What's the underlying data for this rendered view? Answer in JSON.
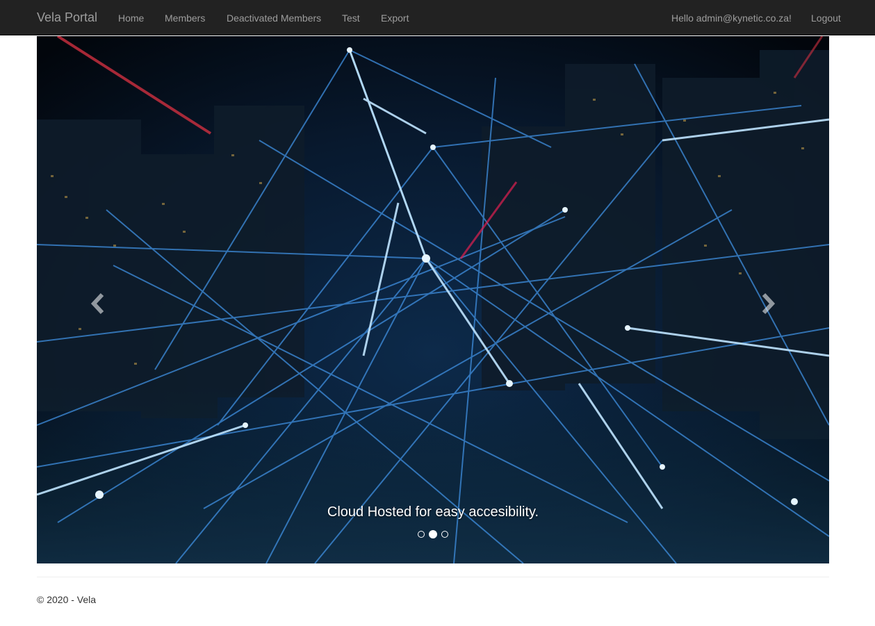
{
  "navbar": {
    "brand": "Vela Portal",
    "items": [
      {
        "label": "Home"
      },
      {
        "label": "Members"
      },
      {
        "label": "Deactivated Members"
      },
      {
        "label": "Test"
      },
      {
        "label": "Export"
      }
    ],
    "greeting": "Hello admin@kynetic.co.za!",
    "logout": "Logout"
  },
  "carousel": {
    "caption": "Cloud Hosted for easy accesibility.",
    "slide_count": 3,
    "active_slide": 2,
    "prev_icon": "chevron-left-icon",
    "next_icon": "chevron-right-icon"
  },
  "footer": {
    "text": "© 2020 - Vela"
  },
  "colors": {
    "navbar_bg": "#222222",
    "nav_text": "#9d9d9d",
    "network_glow": "#4fa8ff"
  }
}
